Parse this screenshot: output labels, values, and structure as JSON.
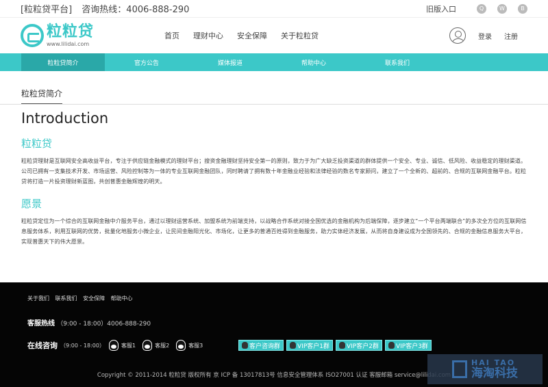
{
  "topbar": {
    "platform": "[粒粒贷平台]",
    "hotline": "咨询热线：4006-888-290",
    "old_entry": "旧版入口",
    "social_icons": [
      "qq-icon",
      "wechat-icon",
      "weibo-icon"
    ]
  },
  "header": {
    "logo_text": "粒粒贷",
    "logo_url": "www.lilidai.com",
    "nav": [
      "首页",
      "理财中心",
      "安全保障",
      "关于粒粒贷"
    ],
    "login": "登录",
    "register": "注册"
  },
  "subnav": {
    "items": [
      "粒粒贷简介",
      "官方公告",
      "媒体报道",
      "帮助中心",
      "联系我们"
    ],
    "active_index": 0
  },
  "content": {
    "breadcrumb": "粒粒贷简介",
    "title": "Introduction",
    "sections": [
      {
        "heading": "粒粒贷",
        "body": "粒粒贷理财是互联网安全高收益平台，专注于供应链金融模式的理财平台；搜资金融理财坚持安全第一的原则，致力于为广大缺乏投资渠道的群体提供一个安全、专业、诚信、低风险、收益稳定的理财渠道。公司已拥有一支集技术开发、市场运营、风险控制等为一体的专业互联网金融团队，同时聘请了拥有数十年金融业经验和法律经验的数名专家顾问，建立了一个全新的、超前的、合规的互联网金融平台。粒粒贷将打造一片投资理财新蓝图，共创普惠金融辉煌的明天。"
      },
      {
        "heading": "愿景",
        "body": "粒粒贷定位为一个综合的互联网金融中介服务平台，通过以理财运营系统、加盟系统为前端支持，以战略合作系统对接全国优选的金融机构为后端保障，逐步建立“一个平台两端联合”的多次全方位的互联网信息服务体系，利用互联网的优势，批量化地服务小微企业，让民间金融阳光化、市场化，让更多的普通百姓得到金融服务，助力实体经济发展，从而将自身建设成为全国领先的、合规的金融信息服务大平台，实现普惠天下的伟大愿景。"
      }
    ]
  },
  "footer": {
    "links": [
      "关于我们",
      "联系我们",
      "安全保障",
      "帮助中心"
    ],
    "hotline_label": "客服热线",
    "hotline_hours": "（9:00 - 18:00）4006-888-290",
    "consult_label": "在线咨询",
    "consult_hours": "（9:00 - 18:00）",
    "agents": [
      "客服1",
      "客服2",
      "客服3"
    ],
    "groups": [
      "客户咨询群",
      "VIP客户1群",
      "VIP客户2群",
      "VIP客户3群"
    ],
    "copyright": "Copyright © 2011-2014 粒粒贷 版权所有 京 ICP 备 13017813号 信息安全管理体系 ISO27001 认证 客服邮箱 service@lilidai.com",
    "watermark_en": "HAI TAO",
    "watermark_cn": "海淘科技"
  },
  "colors": {
    "accent": "#3cc8c8",
    "accent_dark": "#2aa8a8",
    "footer_bg": "#050505"
  }
}
